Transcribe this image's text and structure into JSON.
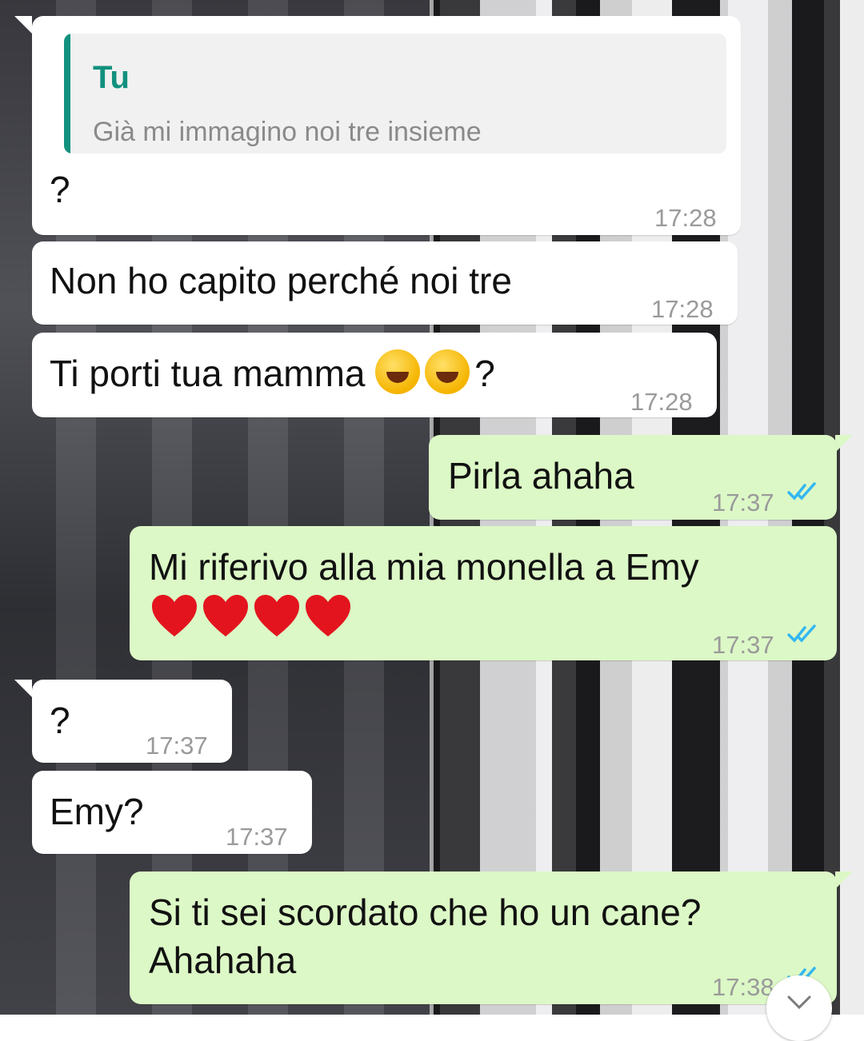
{
  "chat": {
    "messages": [
      {
        "dir": "in",
        "quote_author": "Tu",
        "quote_text": "Già mi immagino noi tre insieme",
        "text": "?",
        "time": "17:28"
      },
      {
        "dir": "in",
        "text": "Non ho capito perché noi tre",
        "time": "17:28"
      },
      {
        "dir": "in",
        "text_before": "Ti porti tua mamma ",
        "emoji": "rolling-on-floor-laughing",
        "text_after": "?",
        "time": "17:28"
      },
      {
        "dir": "out",
        "text": "Pirla ahaha",
        "time": "17:37",
        "status": "read"
      },
      {
        "dir": "out",
        "text": "Mi riferivo alla mia monella a Emy",
        "emoji": "red-heart",
        "time": "17:37",
        "status": "read"
      },
      {
        "dir": "in",
        "text": "?",
        "time": "17:37"
      },
      {
        "dir": "in",
        "text": "Emy?",
        "time": "17:37"
      },
      {
        "dir": "out",
        "text_line1": "Si ti sei scordato che ho un cane?",
        "text_line2": "Ahahaha",
        "time": "17:38",
        "status": "read"
      }
    ]
  },
  "colors": {
    "incoming_bubble": "#ffffff",
    "outgoing_bubble": "#dcf8c6",
    "quote_accent": "#12917e",
    "read_ticks": "#34b7f1",
    "timestamp": "#9a9a9a"
  },
  "icons": {
    "read_receipt": "double-check-icon",
    "scroll_down": "chevron-down-icon"
  }
}
